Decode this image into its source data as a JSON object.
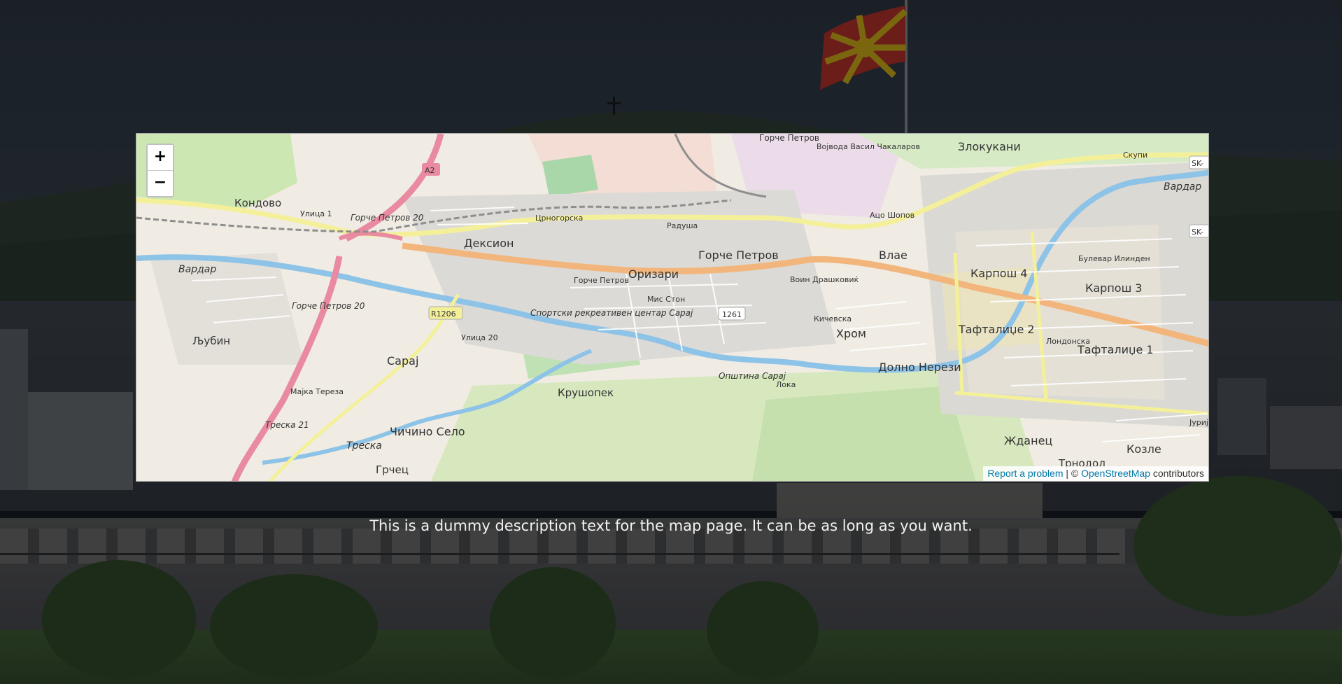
{
  "map": {
    "zoom_in_label": "+",
    "zoom_out_label": "−",
    "labels": {
      "kondovo": "Кондово",
      "deksion": "Дексион",
      "gorche_petrov": "Горче Петров",
      "gorche_petrov_top": "Горче Петров",
      "orizari": "Оризари",
      "vlae": "Влае",
      "zlokukani": "Злокукани",
      "karposh4": "Карпош 4",
      "karposh3": "Карпош 3",
      "ljubin": "Љубин",
      "saraj": "Сарај",
      "hrom": "Хром",
      "taftalidze2": "Тафталиџе 2",
      "taftalidze1": "Тафталиџе 1",
      "dolno_nerezi": "Долно Нерези",
      "krushopek": "Крушопек",
      "chichino_selo": "Чичино Село",
      "grchec": "Грчец",
      "zhdanec": "Жданец",
      "kozle": "Козле",
      "trnodol": "Трнодол",
      "vardar": "Вардар",
      "treska": "Треска",
      "sport_center": "Спортски рекреативен центар Сарај",
      "municipality_saraj": "Општина Сарај",
      "road_a2": "A2",
      "road_r1206": "R1206",
      "road_1261": "1261",
      "road_sk": "SK-",
      "street_ulica1": "Улица 1",
      "street_ulica20": "Улица 20",
      "street_gp20": "Горче Петров 20",
      "street_gp": "Горче Петров",
      "street_majka_tereza": "Мајка Тереза",
      "street_treska21": "Треска 21",
      "street_crnogorska": "Црногорска",
      "street_radusha": "Радуша",
      "street_vojvoda": "Војвода Васил Чакаларов",
      "street_aco_shopov": "Ацо Шопов",
      "street_skupi": "Скупи",
      "street_bulevar_ilinden": "Булевар Илинден",
      "street_voin_drashkovik": "Воин Драшковиќ",
      "street_kicheva": "Кичевска",
      "street_mis_stone": "Мис Стон",
      "street_londonska": "Лондонска",
      "street_loka": "Лока",
      "street_jurij": "Јуриј"
    },
    "attribution": {
      "report_link": "Report a problem",
      "separator": " | © ",
      "osm_link": "OpenStreetMap",
      "suffix": " contributors"
    }
  },
  "description": "This is a dummy description text for the map page. It can be as long as you want."
}
